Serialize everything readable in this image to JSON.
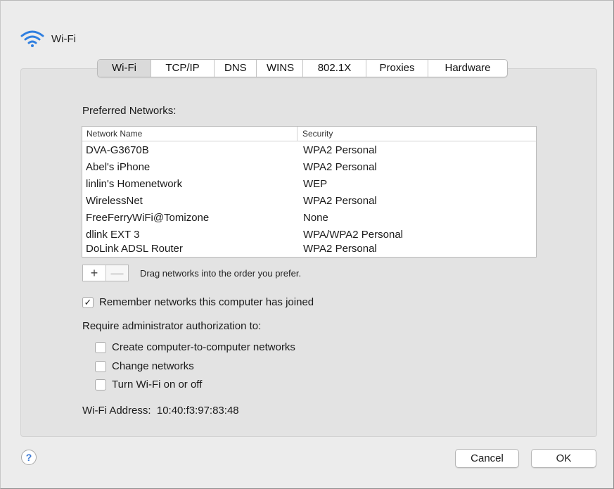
{
  "header": {
    "title": "Wi-Fi",
    "icon": "wifi-icon"
  },
  "tabs": [
    {
      "label": "Wi-Fi",
      "selected": true
    },
    {
      "label": "TCP/IP"
    },
    {
      "label": "DNS"
    },
    {
      "label": "WINS"
    },
    {
      "label": "802.1X"
    },
    {
      "label": "Proxies"
    },
    {
      "label": "Hardware"
    }
  ],
  "preferred": {
    "label": "Preferred Networks:",
    "columns": [
      "Network Name",
      "Security"
    ],
    "rows": [
      {
        "name": "DVA-G3670B",
        "security": "WPA2 Personal"
      },
      {
        "name": "Abel's iPhone",
        "security": "WPA2 Personal"
      },
      {
        "name": "linlin's Homenetwork",
        "security": "WEP"
      },
      {
        "name": "WirelessNet",
        "security": "WPA2 Personal"
      },
      {
        "name": "FreeFerryWiFi@Tomizone",
        "security": "None"
      },
      {
        "name": "dlink EXT 3",
        "security": "WPA/WPA2 Personal"
      },
      {
        "name": "DoLink ADSL Router",
        "security": "WPA2 Personal"
      }
    ],
    "add_symbol": "+",
    "remove_symbol": "—",
    "drag_hint": "Drag networks into the order you prefer."
  },
  "options": {
    "remember": {
      "label": "Remember networks this computer has joined",
      "checked": true,
      "check_symbol": "✓"
    },
    "require_label": "Require administrator authorization to:",
    "create": {
      "label": "Create computer-to-computer networks",
      "checked": false
    },
    "change": {
      "label": "Change networks",
      "checked": false
    },
    "turn": {
      "label": "Turn Wi-Fi on or off",
      "checked": false
    }
  },
  "address": {
    "label": "Wi-Fi Address:",
    "value": "10:40:f3:97:83:48"
  },
  "footer": {
    "help": "?",
    "cancel": "Cancel",
    "ok": "OK"
  },
  "colors": {
    "wifi_blue": "#2f7fe0",
    "help_blue": "#3a78d4"
  }
}
